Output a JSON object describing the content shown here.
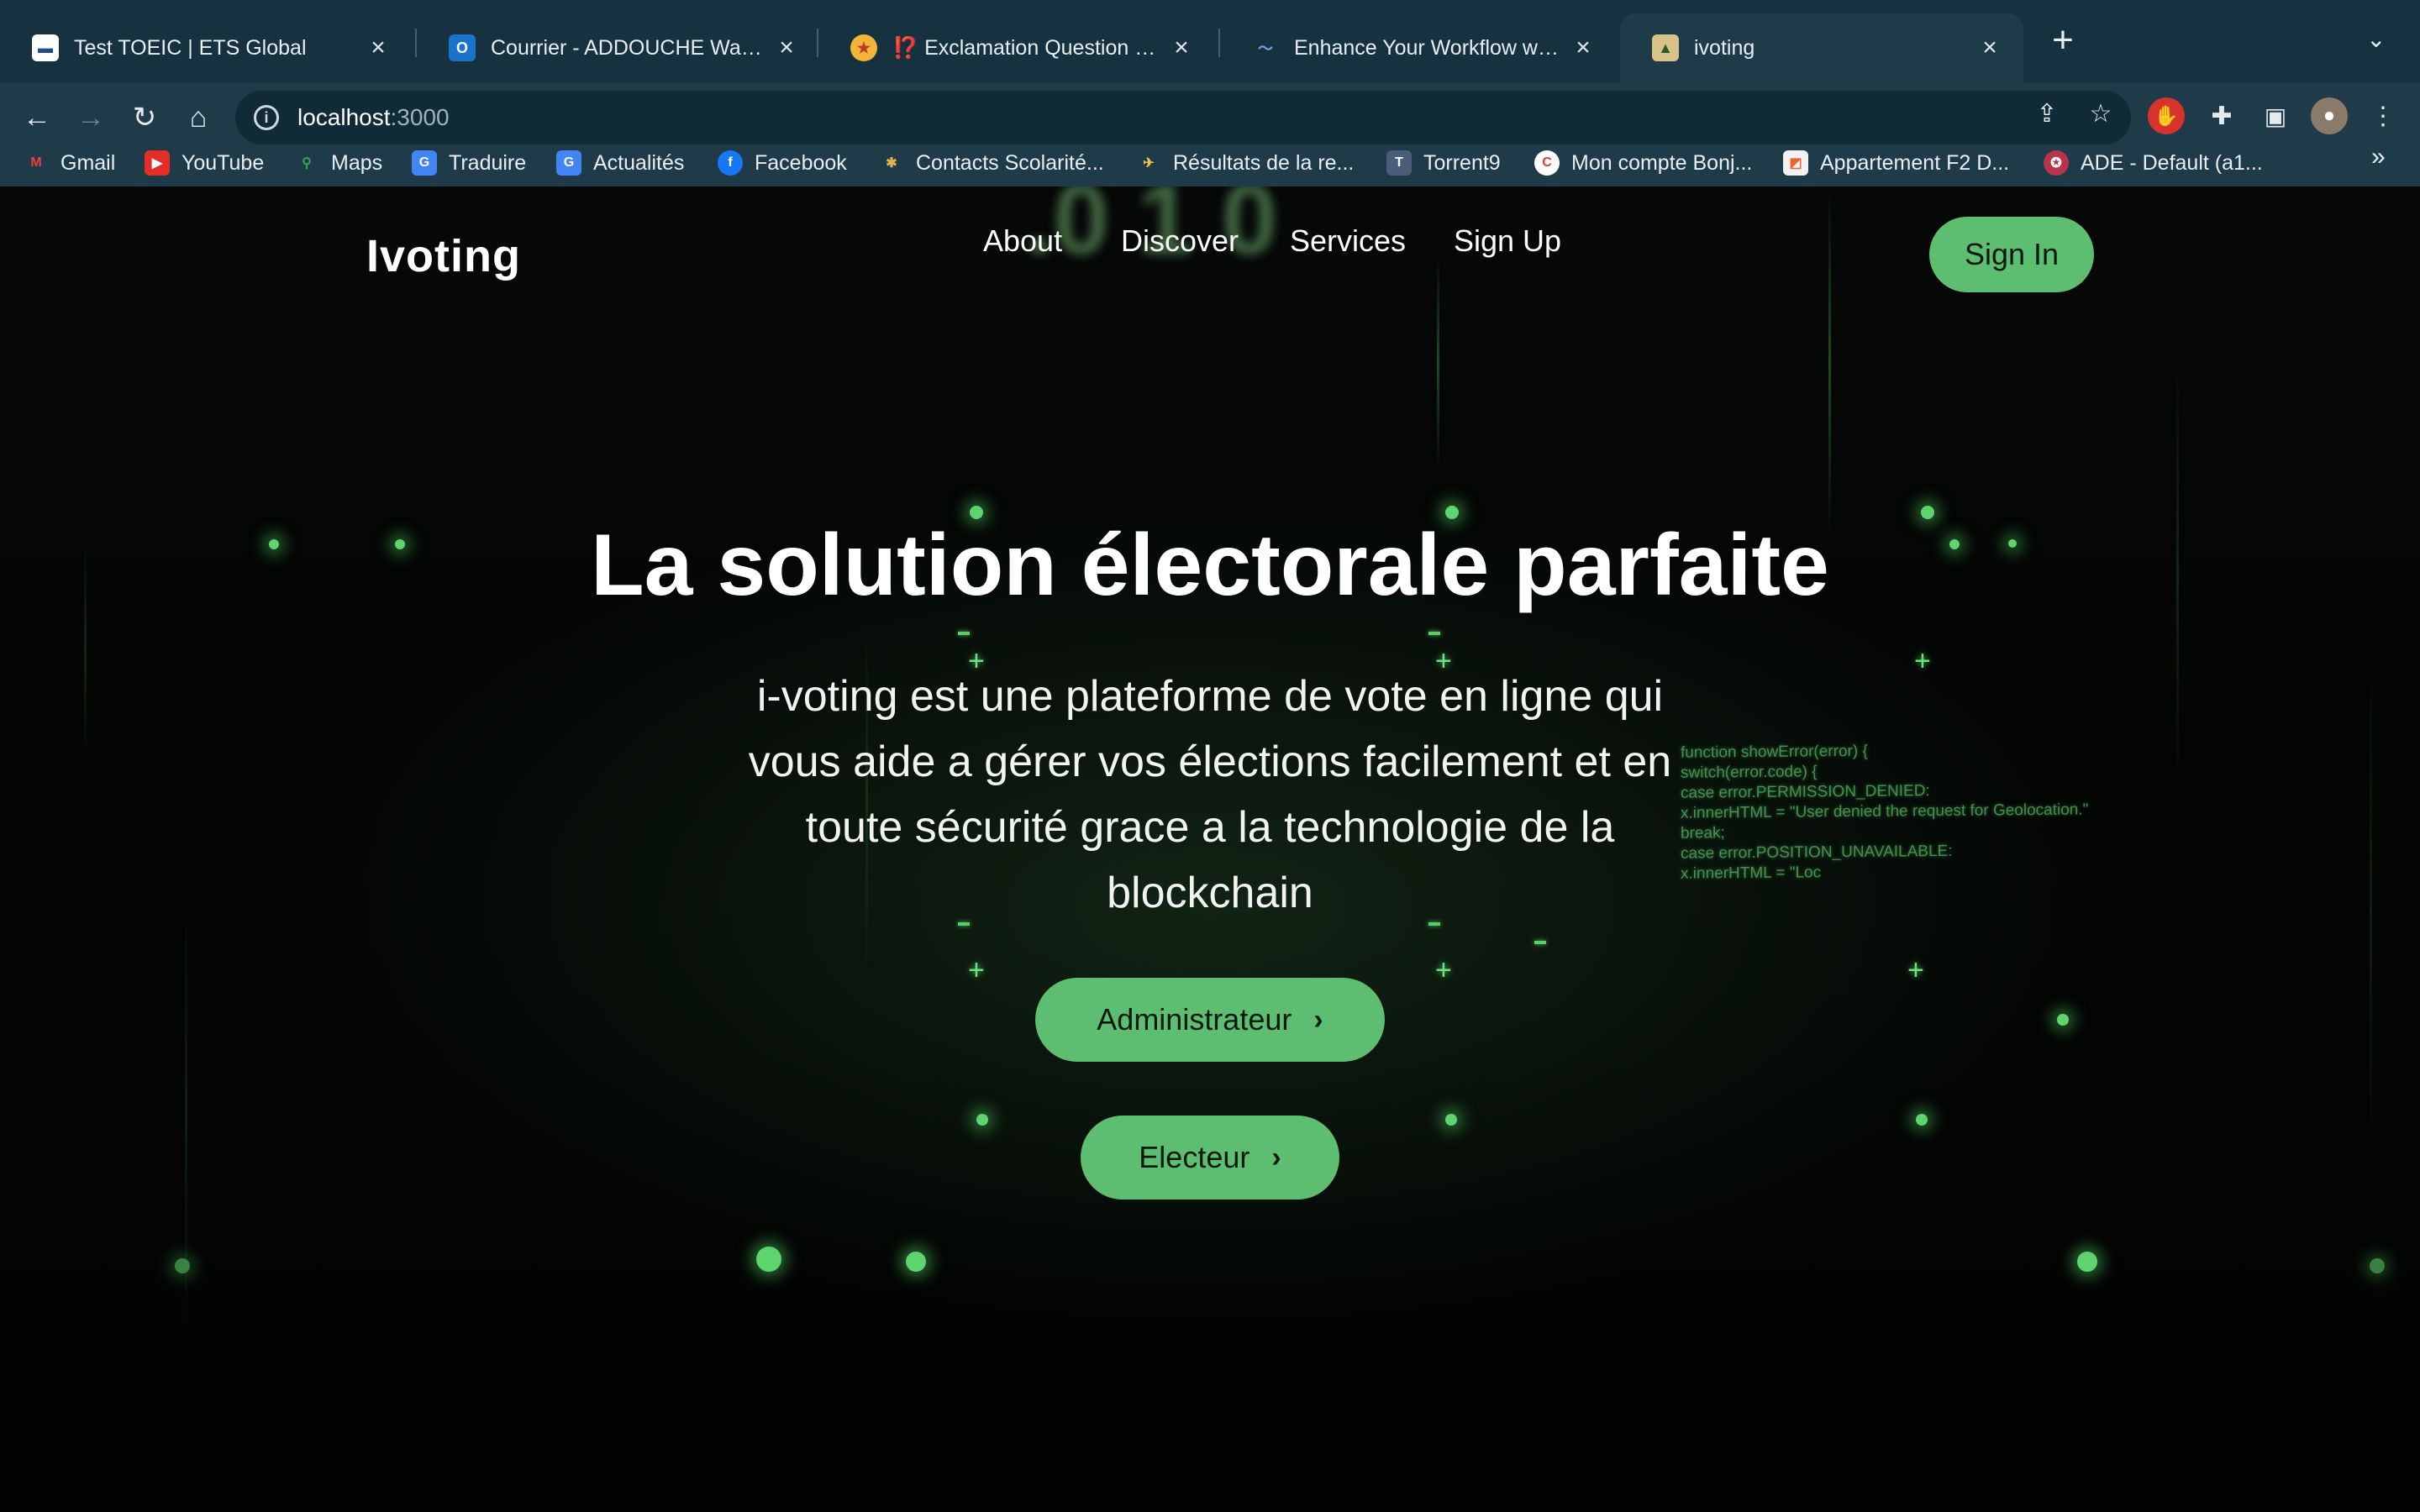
{
  "browser": {
    "tabs": [
      {
        "title": "Test TOEIC | ETS Global",
        "active": false
      },
      {
        "title": "Courrier - ADDOUCHE Walid - Outlook",
        "active": false
      },
      {
        "title": "⁉️ Exclamation Question Mark",
        "active": false
      },
      {
        "title": "Enhance Your Workflow with C",
        "active": false
      },
      {
        "title": "ivoting",
        "active": true
      }
    ],
    "address": {
      "host": "localhost",
      "port": ":3000"
    },
    "bookmarks": [
      "Gmail",
      "YouTube",
      "Maps",
      "Traduire",
      "Actualités",
      "Facebook",
      "Contacts Scolarité...",
      "Résultats de la re...",
      "Torrent9",
      "Mon compte Bonj...",
      "Appartement F2 D...",
      "ADE - Default (a1..."
    ]
  },
  "site": {
    "brand": "Ivoting",
    "nav": [
      "About",
      "Discover",
      "Services",
      "Sign Up"
    ],
    "signin": "Sign In",
    "hero": {
      "title": "La solution électorale parfaite",
      "subtitle": "i-voting est une plateforme de vote en ligne qui vous aide a gérer vos élections facilement et en toute sécurité grace a la technologie de la blockchain"
    },
    "buttons": {
      "admin": "Administrateur",
      "voter": "Electeur"
    },
    "background_code": [
      "function showError(error) {",
      "  switch(error.code) {",
      "    case error.PERMISSION_DENIED:",
      "      x.innerHTML = \"User denied the request for Geolocation.\"",
      "      break;",
      "    case error.POSITION_UNAVAILABLE:",
      "      x.innerHTML = \"Loc"
    ]
  },
  "colors": {
    "accent": "#5dbe72",
    "chrome": "#1f3b4a",
    "tabstrip": "#163241"
  }
}
